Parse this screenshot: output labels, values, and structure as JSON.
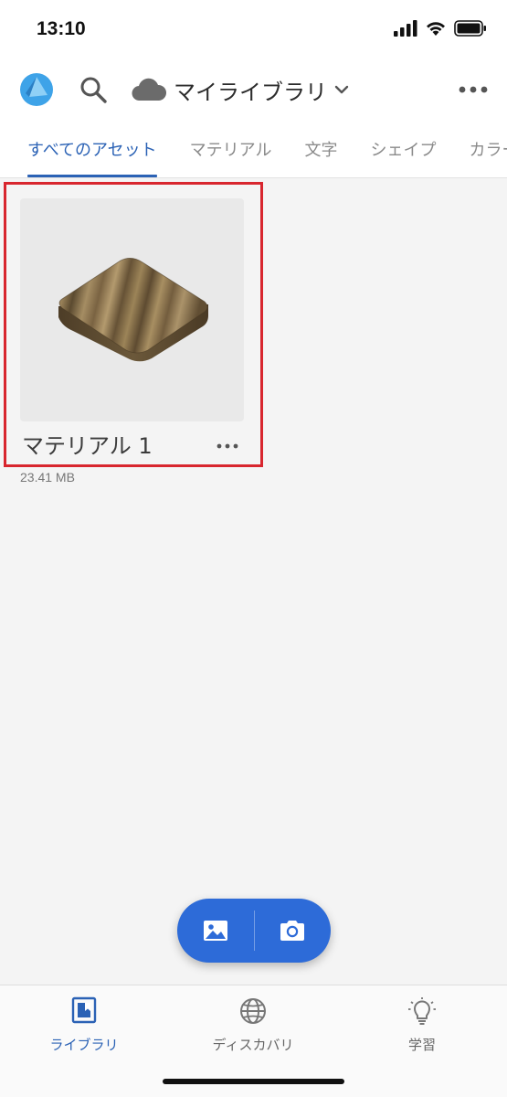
{
  "status_bar": {
    "time": "13:10"
  },
  "header": {
    "library_title": "マイライブラリ"
  },
  "tabs": [
    {
      "label": "すべてのアセット",
      "active": true
    },
    {
      "label": "マテリアル",
      "active": false
    },
    {
      "label": "文字",
      "active": false
    },
    {
      "label": "シェイプ",
      "active": false
    },
    {
      "label": "カラー",
      "active": false
    }
  ],
  "assets": [
    {
      "name": "マテリアル 1",
      "size": "23.41 MB"
    }
  ],
  "bottom_nav": [
    {
      "label": "ライブラリ",
      "icon": "library-icon",
      "active": true
    },
    {
      "label": "ディスカバリ",
      "icon": "globe-icon",
      "active": false
    },
    {
      "label": "学習",
      "icon": "lightbulb-icon",
      "active": false
    }
  ],
  "colors": {
    "accent": "#2b62b5",
    "fab": "#2d6bd8",
    "highlight": "#d8262e"
  }
}
